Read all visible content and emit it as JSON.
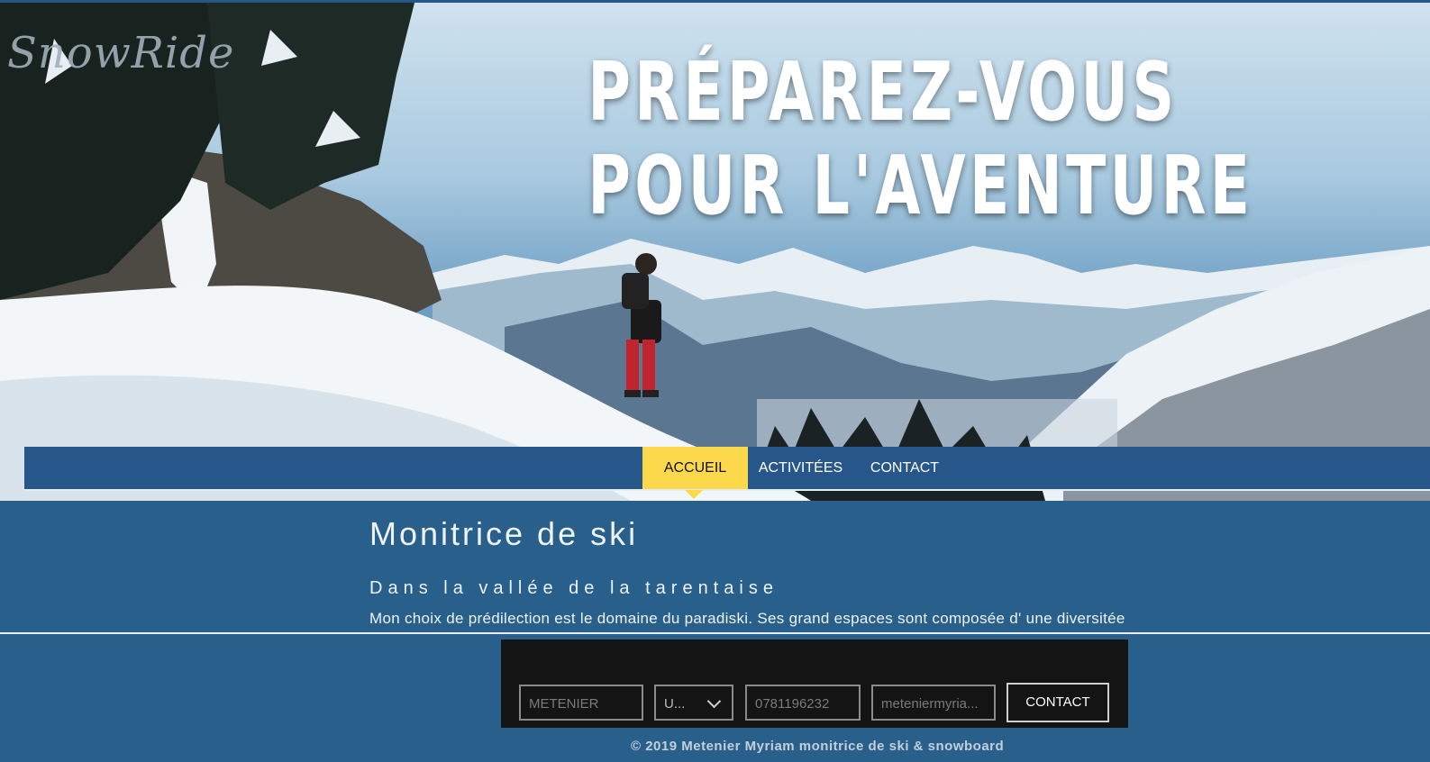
{
  "brand": {
    "logo_text": "SnowRide"
  },
  "hero": {
    "headline_line1": "PRÉPAREZ-VOUS",
    "headline_line2": "POUR L'AVENTURE"
  },
  "nav": {
    "items": [
      {
        "label": "ACCUEIL",
        "active": true
      },
      {
        "label": "ACTIVITÉES",
        "active": false
      },
      {
        "label": "CONTACT",
        "active": false
      }
    ]
  },
  "content": {
    "title": "Monitrice de ski",
    "subtitle": "Dans la vallée de la tarentaise",
    "paragraph": "Mon choix de prédilection est le domaine du paradiski. Ses grand espaces sont composée d' une diversitée"
  },
  "form": {
    "name_placeholder": "METENIER",
    "select_value": "U...",
    "phone_placeholder": "0781196232",
    "email_placeholder": "meteniermyria...",
    "submit_label": "CONTACT"
  },
  "footer": {
    "text": "© 2019 Metenier Myriam monitrice de ski & snowboard"
  },
  "colors": {
    "nav_bg": "#27578a",
    "active_tab": "#fbd94b",
    "page_bg": "#285f8b",
    "form_bg": "#141414"
  },
  "icons": {
    "select_arrow": "chevron-down-icon"
  }
}
